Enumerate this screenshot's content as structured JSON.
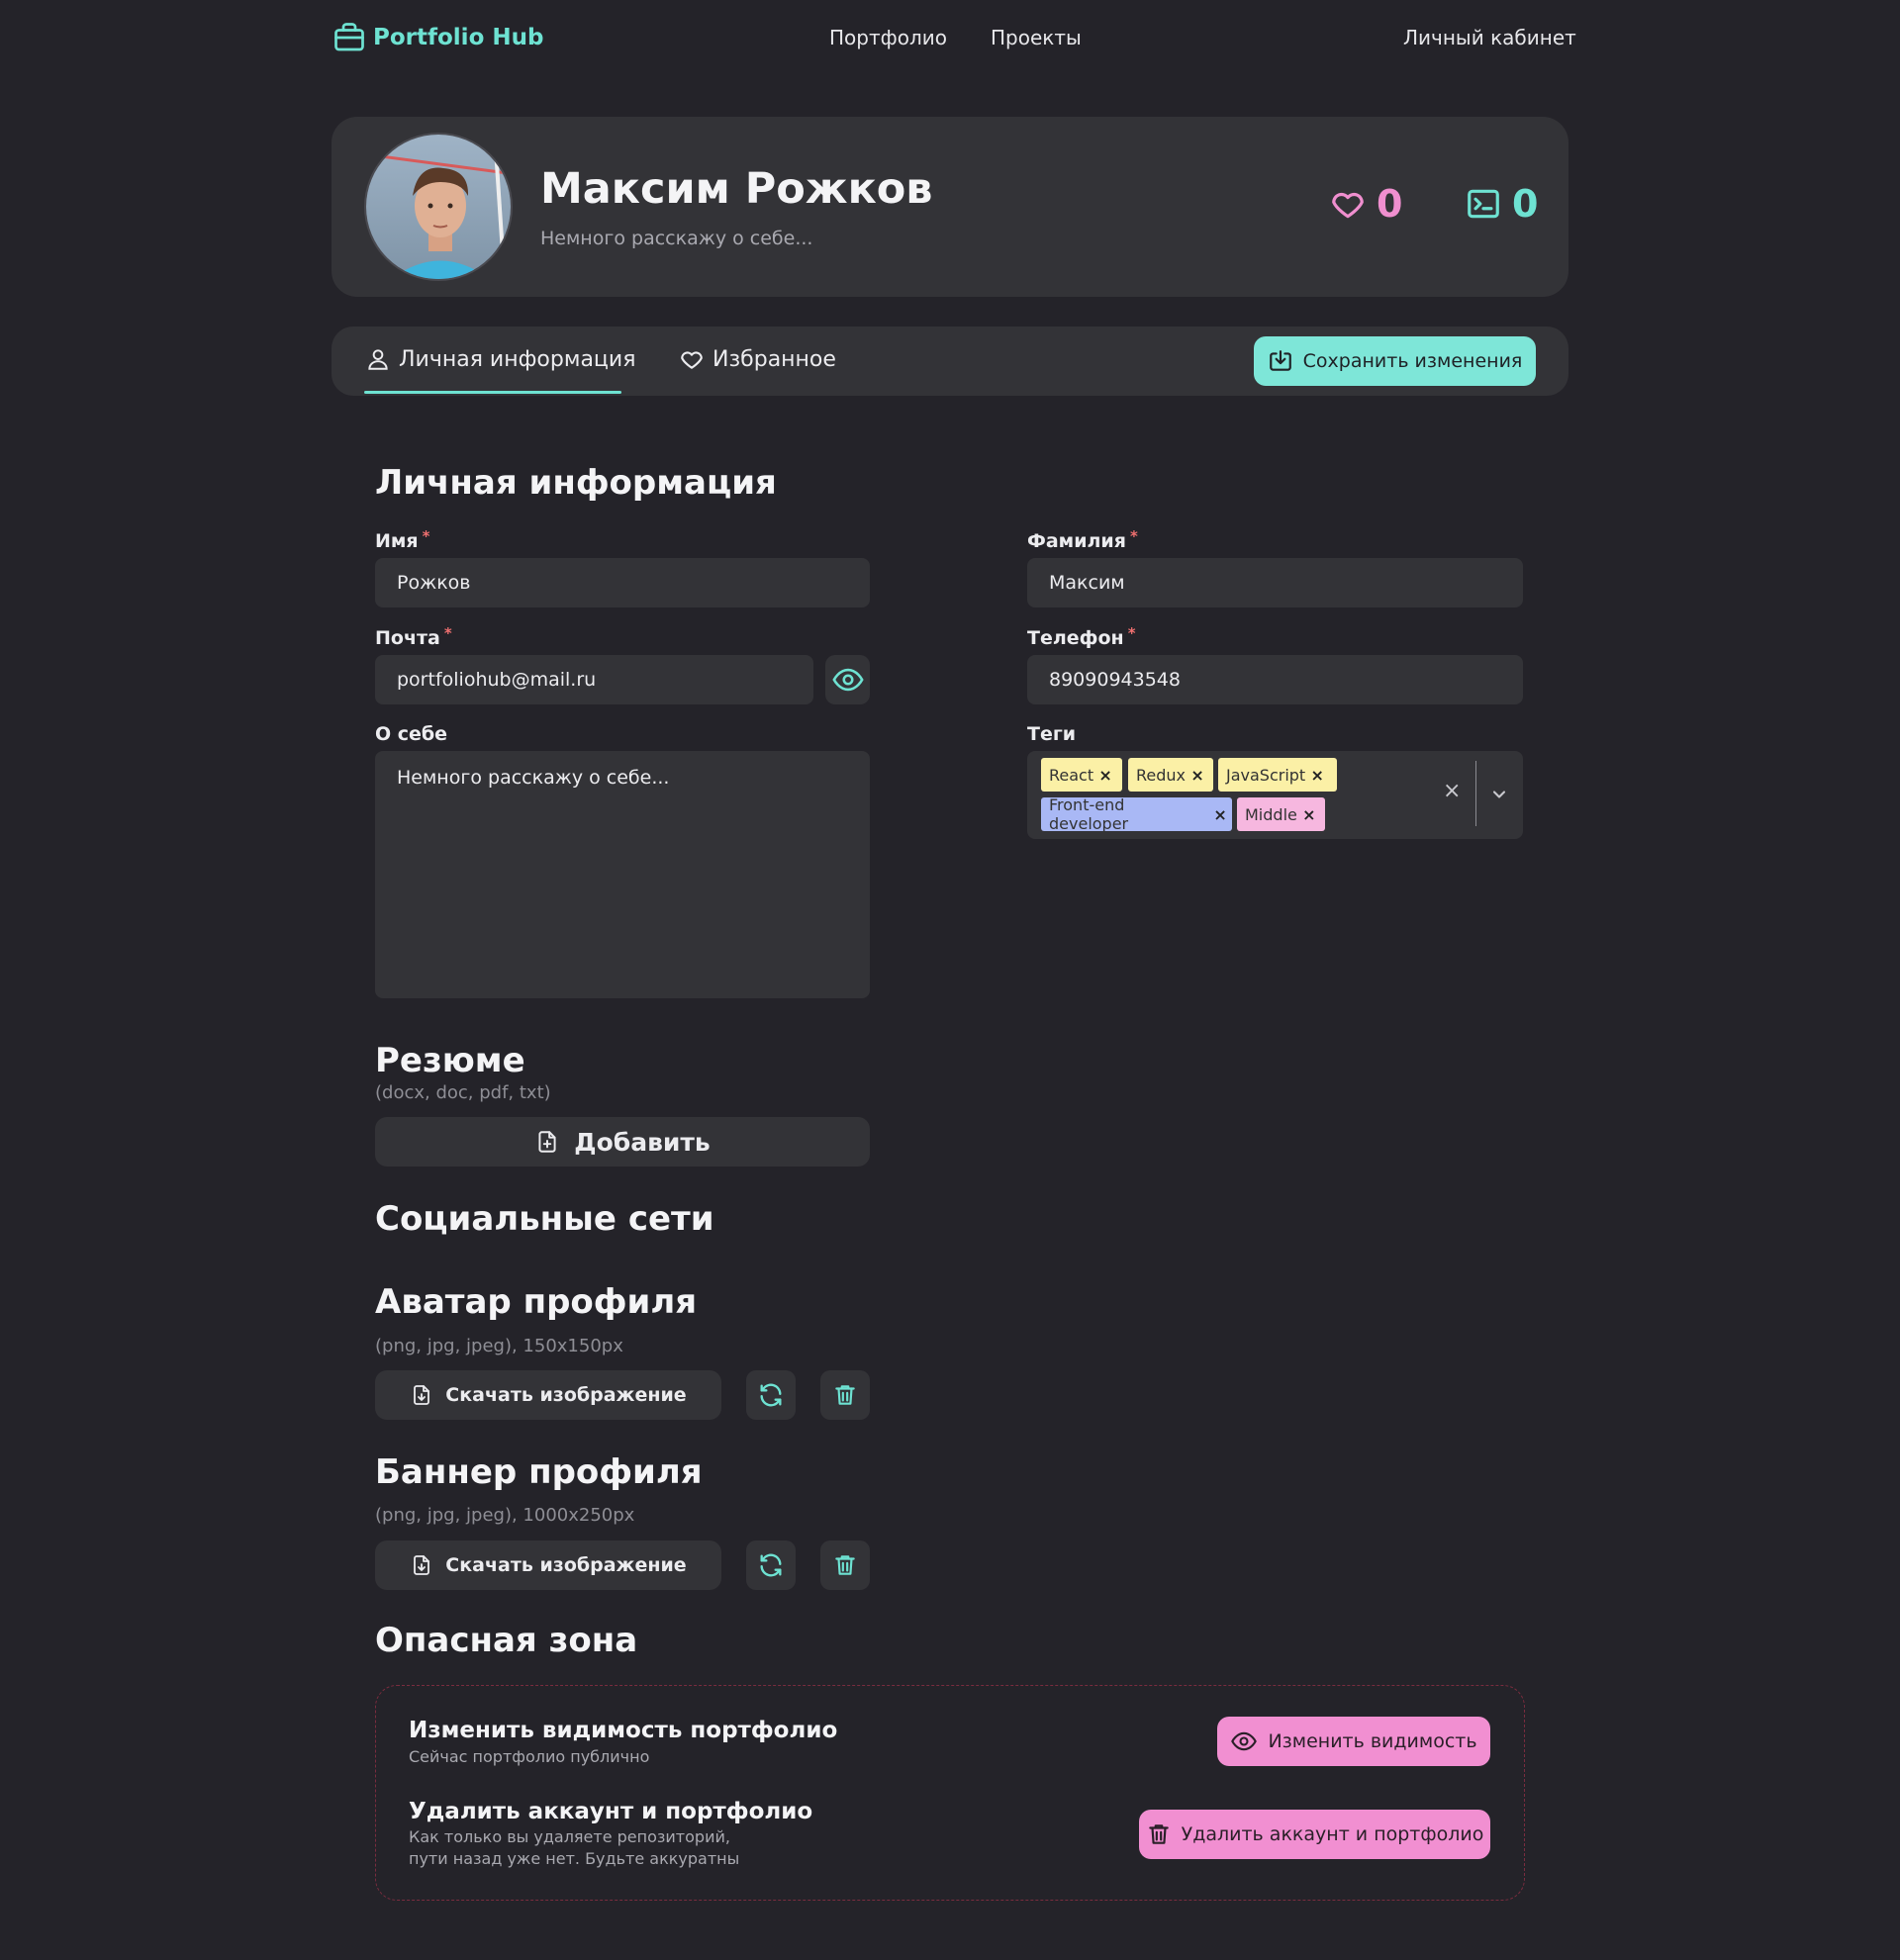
{
  "header": {
    "logo_text": "Portfolio Hub",
    "nav": [
      "Портфолио",
      "Проекты"
    ],
    "account_link": "Личный кабинет"
  },
  "profile": {
    "name": "Максим Рожков",
    "about": "Немного расскажу о себе...",
    "likes_count": "0",
    "projects_count": "0"
  },
  "tabs": {
    "personal": "Личная информация",
    "favorites": "Избранное",
    "save_label": "Сохранить изменения"
  },
  "form": {
    "section_title": "Личная информация",
    "first_name_label": "Имя",
    "first_name_value": "Рожков",
    "last_name_label": "Фамилия",
    "last_name_value": "Максим",
    "email_label": "Почта",
    "email_value": "portfoliohub@mail.ru",
    "phone_label": "Телефон",
    "phone_value": "89090943548",
    "about_label": "О себе",
    "about_value": "Немного расскажу о себе...",
    "tags_label": "Теги",
    "required_mark": "*",
    "tags": [
      {
        "label": "React",
        "color": "#fbf0a6"
      },
      {
        "label": "Redux",
        "color": "#fbf0a6"
      },
      {
        "label": "JavaScript",
        "color": "#fbf0a6"
      },
      {
        "label": "Front-end developer",
        "color": "#a9b8f5"
      },
      {
        "label": "Middle",
        "color": "#f6b7df"
      }
    ],
    "tag_remove": "×",
    "clear_icon": "×"
  },
  "resume": {
    "title": "Резюме",
    "formats": "(docx, doc, pdf, txt)",
    "add_label": "Добавить"
  },
  "social": {
    "title": "Социальные сети"
  },
  "avatar_section": {
    "title": "Аватар профиля",
    "hint": "(png, jpg, jpeg), 150x150px",
    "download_label": "Скачать изображение"
  },
  "banner_section": {
    "title": "Баннер профиля",
    "hint": "(png, jpg, jpeg), 1000x250px",
    "download_label": "Скачать изображение"
  },
  "danger": {
    "title": "Опасная зона",
    "visibility_title": "Изменить видимость портфолио",
    "visibility_sub": "Сейчас портфолио публично",
    "visibility_button": "Изменить видимость",
    "delete_title": "Удалить аккаунт и портфолио",
    "delete_sub_line1": "Как только вы удаляете репозиторий,",
    "delete_sub_line2": "пути назад уже нет. Будьте аккуратны",
    "delete_button": "Удалить аккаунт и портфолио"
  },
  "colors": {
    "background": "#242329",
    "card": "#333337",
    "accent_teal": "#6ee2d2",
    "accent_pink": "#f08fcf",
    "danger_border": "#7a2c3e"
  }
}
